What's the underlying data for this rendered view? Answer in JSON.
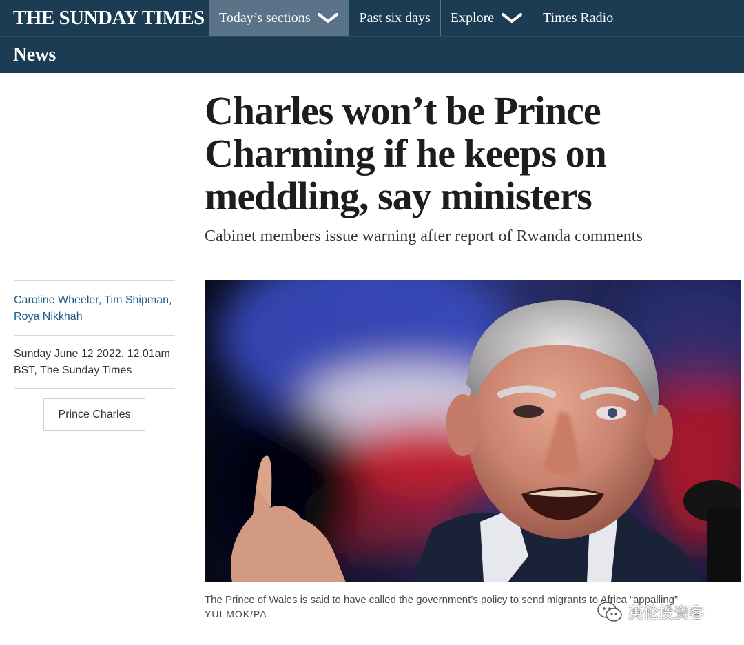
{
  "nav": {
    "masthead": "THE SUNDAY TIMES",
    "items": [
      {
        "label": "Today’s sections",
        "has_dropdown": true,
        "active": true
      },
      {
        "label": "Past six days",
        "has_dropdown": false,
        "active": false
      },
      {
        "label": "Explore",
        "has_dropdown": true,
        "active": false
      },
      {
        "label": "Times Radio",
        "has_dropdown": false,
        "active": false
      }
    ]
  },
  "section": {
    "title": "News"
  },
  "article": {
    "headline_lines": [
      "Charles won’t be Prince",
      "Charming if he keeps on",
      "meddling, say ministers"
    ],
    "standfirst": "Cabinet members issue warning after report of Rwanda comments",
    "authors_line1": "Caroline Wheeler, Tim Shipman,",
    "authors_line2": "Roya Nikkhah",
    "date_line1": "Sunday June 12 2022, 12.01am",
    "date_line2": "BST, The Sunday Times",
    "tag": "Prince Charles",
    "caption": "The Prince of Wales is said to have called the government’s policy to send migrants to Africa “appalling”",
    "credit": "YUI MOK/PA"
  },
  "watermark": {
    "text": "英伦投资客"
  },
  "colors": {
    "nav_bg": "#1c3c54",
    "nav_active": "#5a7388",
    "author_link": "#1d5c8a"
  },
  "icons": {
    "dropdown": "chevron-down-icon",
    "watermark": "wechat-icon"
  }
}
